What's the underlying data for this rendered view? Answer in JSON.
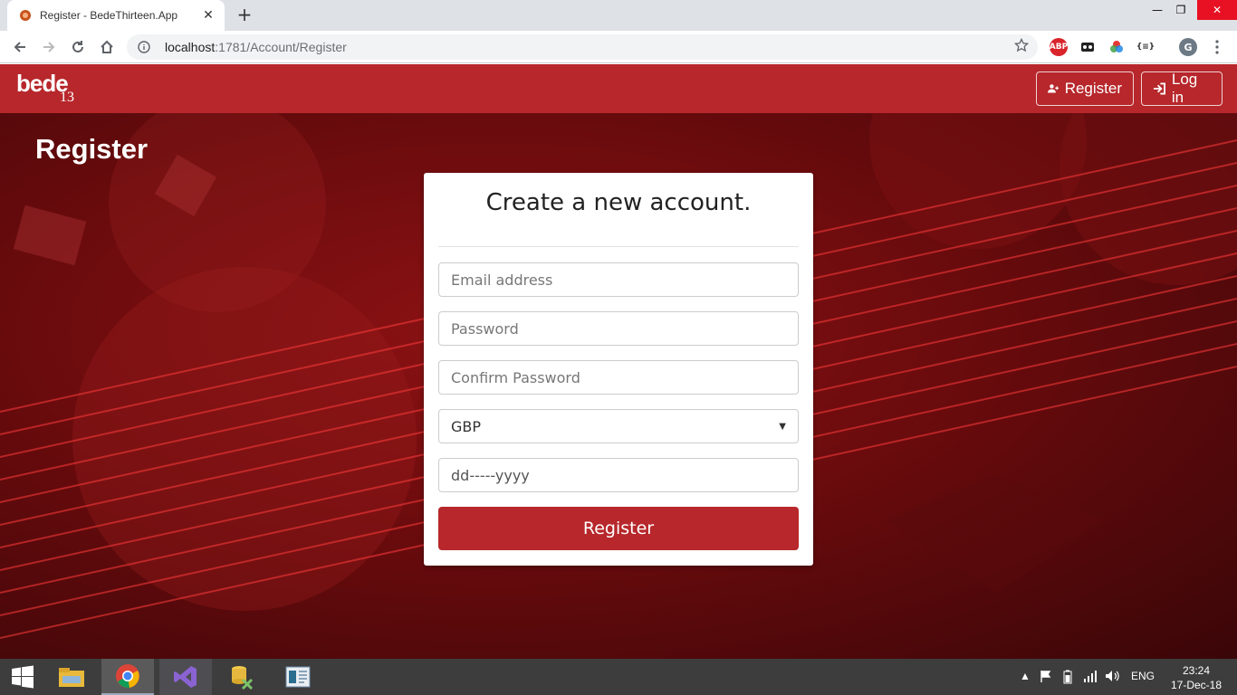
{
  "browser": {
    "tab_title": "Register - BedeThirteen.App",
    "tab_close": "✕",
    "new_tab": "+",
    "url_host": "localhost",
    "url_path": ":1781/Account/Register",
    "window_controls": {
      "minimize": "—",
      "restore": "❐",
      "close": "✕"
    },
    "extensions": [
      "ABP",
      "{≡}"
    ],
    "profile_initial": "G"
  },
  "app": {
    "logo_word": "bede",
    "logo_number": "13",
    "nav": {
      "register": "Register",
      "login": "Log in"
    },
    "brand_color": "#b7272b"
  },
  "page": {
    "title": "Register",
    "card": {
      "heading": "Create a new account.",
      "email_placeholder": "Email address",
      "password_placeholder": "Password",
      "confirm_placeholder": "Confirm Password",
      "currency_selected": "GBP",
      "date_placeholder": "dd-----yyyy",
      "submit_label": "Register"
    }
  },
  "taskbar": {
    "language": "ENG",
    "time": "23:24",
    "date": "17-Dec-18"
  }
}
